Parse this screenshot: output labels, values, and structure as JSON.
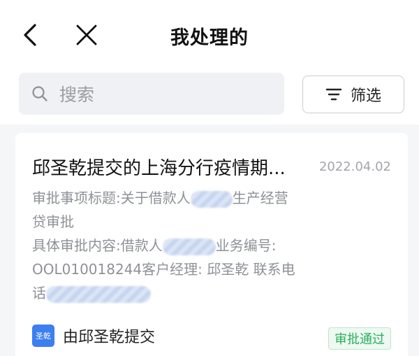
{
  "header": {
    "title": "我处理的",
    "back_icon": "chevron-left-icon",
    "close_icon": "close-icon"
  },
  "search": {
    "placeholder": "搜索",
    "icon": "search-icon"
  },
  "filter": {
    "label": "筛选",
    "icon": "filter-icon"
  },
  "card": {
    "title": "邱圣乾提交的上海分行疫情期...",
    "date": "2022.04.02",
    "line1_prefix": "审批事项标题:关于借款人",
    "line1_suffix": "生产经营",
    "line2": "贷审批",
    "line3_prefix": "具体审批内容:借款人",
    "line3_suffix": "业务编号:",
    "line4": "OOL010018244客户经理:  邱圣乾 联系电",
    "line5_prefix": "话",
    "avatar_text": "圣乾",
    "submitter": "由邱圣乾提交",
    "status": "审批通过",
    "status_color": "#2bae5a"
  }
}
